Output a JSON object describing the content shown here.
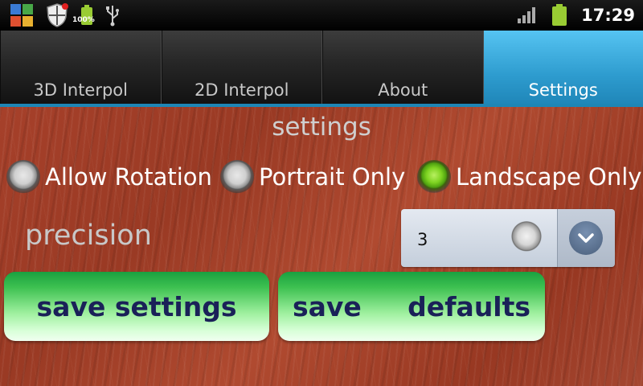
{
  "status_bar": {
    "time": "17:29",
    "battery_percent_label": "100%",
    "icons": [
      "app-launcher-icon",
      "shield-icon",
      "battery-icon",
      "usb-icon",
      "signal-icon",
      "battery-icon"
    ]
  },
  "tabs": [
    {
      "label": "3D Interpol",
      "active": false
    },
    {
      "label": "2D Interpol",
      "active": false
    },
    {
      "label": "About",
      "active": false
    },
    {
      "label": "Settings",
      "active": true
    }
  ],
  "settings": {
    "title": "settings",
    "orientation_options": [
      {
        "label": "Allow Rotation",
        "checked": false
      },
      {
        "label": "Portrait Only",
        "checked": false
      },
      {
        "label": "Landscape Only",
        "checked": true
      }
    ],
    "precision_label": "precision",
    "precision_value": "3",
    "save_settings_label": "save settings",
    "save_defaults_label": "save     defaults"
  },
  "colors": {
    "active_tab": "#2e9ccf",
    "button_green": "#3cc050",
    "button_text": "#1a2158",
    "checked_radio": "#7ed321"
  }
}
